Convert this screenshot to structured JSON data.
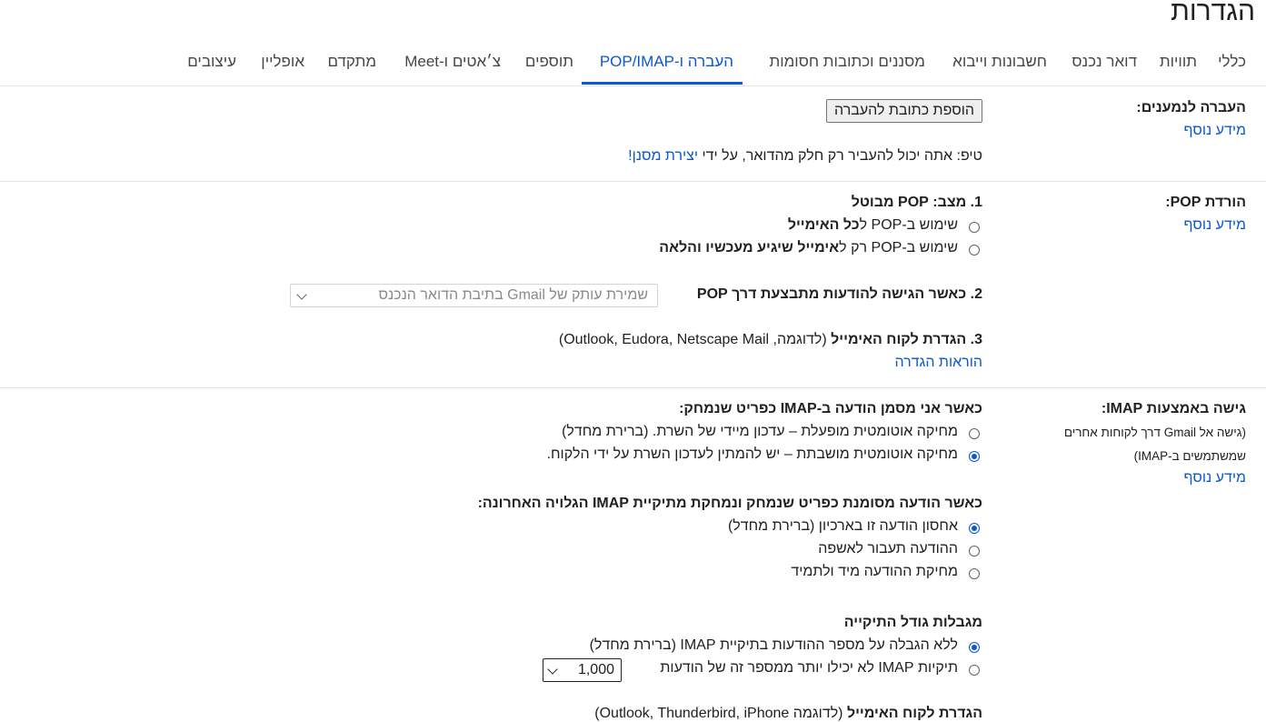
{
  "page_title": "הגדרות",
  "tabs": [
    {
      "label": "כללי"
    },
    {
      "label": "תוויות"
    },
    {
      "label": "דואר נכנס"
    },
    {
      "label": "חשבונות וייבוא"
    },
    {
      "label": "מסננים וכתובות חסומות"
    },
    {
      "label": "העברה ו-POP/IMAP"
    },
    {
      "label": "תוספים"
    },
    {
      "label": "צ׳אטים ו-Meet"
    },
    {
      "label": "מתקדם"
    },
    {
      "label": "אופליין"
    },
    {
      "label": "עיצובים"
    }
  ],
  "forwarding": {
    "label": "העברה לנמענים:",
    "learn_more": "מידע נוסף",
    "add_button": "הוספת כתובת להעברה",
    "tip_prefix": "טיפ: אתה יכול להעביר רק חלק מהדואר, על ידי",
    "tip_link": "יצירת מסנן!"
  },
  "pop": {
    "label": "הורדת POP:",
    "learn_more": "מידע נוסף",
    "status_heading": "1. מצב: POP מבוטל",
    "option_all_prefix": "שימוש ב-POP ל",
    "option_all_bold": "כל האימייל",
    "option_new_prefix": "שימוש ב-POP רק ל",
    "option_new_bold": "אימייל שיגיע מעכשיו והלאה",
    "access_heading": "2. כאשר הגישה להודעות מתבצעת דרך POP",
    "access_select_value": "שמירת עותק של Gmail בתיבת הדואר הנכנס",
    "client_heading": "3. הגדרת לקוח האימייל",
    "client_examples": "(לדוגמה, Outlook, Eudora, Netscape Mail)",
    "instructions_link": "הוראות הגדרה"
  },
  "imap": {
    "label": "גישה באמצעות IMAP:",
    "sub1": "(גישה אל Gmail דרך לקוחות אחרים",
    "sub2": "שמשתמשים ב-IMAP)",
    "learn_more": "מידע נוסף",
    "deleted_heading": "כאשר אני מסמן הודעה ב-IMAP כפריט שנמחק:",
    "auto_expunge_on": "מחיקה אוטומטית מופעלת – עדכון מיידי של השרת. (ברירת מחדל)",
    "auto_expunge_off": "מחיקה אוטומטית מושבתת – יש להמתין לעדכון השרת על ידי הלקוח.",
    "expunged_heading": "כאשר הודעה מסומנת כפריט שנמחק ונמחקת מתיקיית IMAP הגלויה האחרונה:",
    "archive_option": "אחסון הודעה זו בארכיון (ברירת מחדל)",
    "trash_option": "ההודעה תעבור לאשפה",
    "delete_forever_option": "מחיקת ההודעה מיד ולתמיד",
    "folder_limits_heading": "מגבלות גודל התיקייה",
    "no_limit_option": "ללא הגבלה על מספר ההודעות בתיקיית IMAP (ברירת מחדל)",
    "limit_option": "תיקיות IMAP לא יכילו יותר ממספר זה של הודעות",
    "limit_value": "1,000",
    "client_heading": "הגדרת לקוח האימייל",
    "client_examples": "(לדוגמה Outlook, Thunderbird, iPhone)"
  },
  "colors": {
    "accent": "#0b57d0",
    "text": "#202124",
    "divider": "#e3e3e3"
  }
}
